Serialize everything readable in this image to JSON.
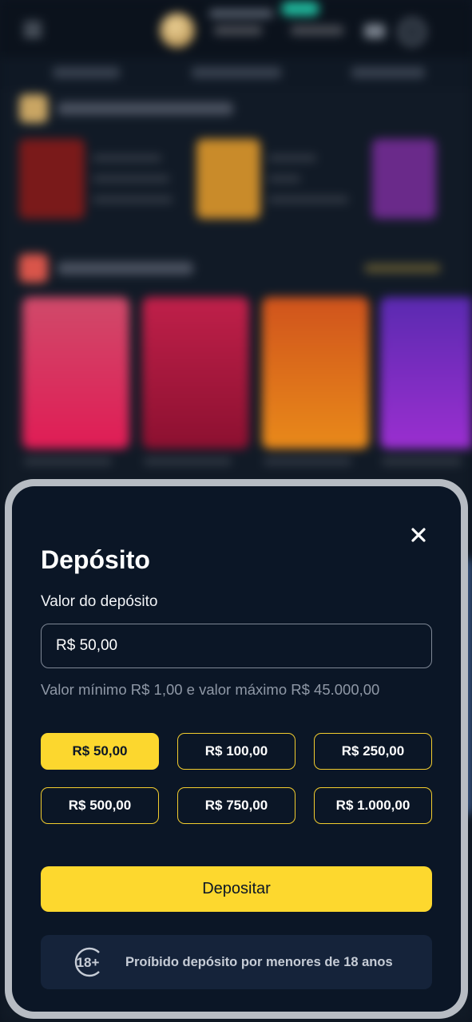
{
  "modal": {
    "title": "Depósito",
    "field_label": "Valor do depósito",
    "amount_value": "R$ 50,00",
    "limits_text": "Valor mínimo R$ 1,00 e valor máximo R$ 45.000,00",
    "quick_amounts": [
      {
        "label": "R$ 50,00",
        "selected": true
      },
      {
        "label": "R$ 100,00",
        "selected": false
      },
      {
        "label": "R$ 250,00",
        "selected": false
      },
      {
        "label": "R$ 500,00",
        "selected": false
      },
      {
        "label": "R$ 750,00",
        "selected": false
      },
      {
        "label": "R$ 1.000,00",
        "selected": false
      }
    ],
    "submit_label": "Depositar",
    "age_badge": "18+",
    "age_notice": "Proíbido depósito por menores de 18 anos",
    "close_icon": "close-icon"
  },
  "colors": {
    "accent": "#fcd72e",
    "modal_bg": "#0b1626",
    "notice_bg": "#15233a"
  }
}
